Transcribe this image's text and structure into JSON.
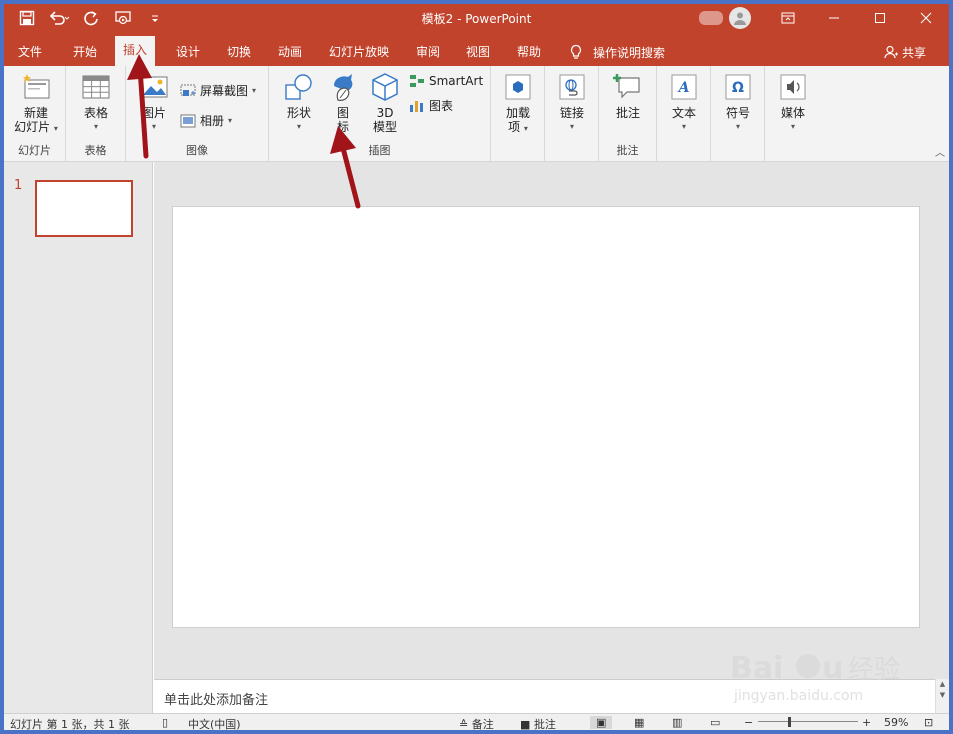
{
  "window": {
    "title": "模板2  -  PowerPoint",
    "buttons": {
      "restore": "⧉",
      "minimize": "—",
      "maximize": "☐",
      "close": "✕"
    }
  },
  "tabs": [
    {
      "label": "文件"
    },
    {
      "label": "开始"
    },
    {
      "label": "插入",
      "active": true
    },
    {
      "label": "设计"
    },
    {
      "label": "切换"
    },
    {
      "label": "动画"
    },
    {
      "label": "幻灯片放映"
    },
    {
      "label": "审阅"
    },
    {
      "label": "视图"
    },
    {
      "label": "帮助"
    }
  ],
  "tell_me": "操作说明搜索",
  "share": "共享",
  "ribbon": {
    "new_slide": {
      "line1": "新建",
      "line2": "幻灯片"
    },
    "slides_group": "幻灯片",
    "table": "表格",
    "tables_group": "表格",
    "pictures": "图片",
    "screenshot": "屏幕截图",
    "album": "相册",
    "images_group": "图像",
    "shapes": "形状",
    "icons": {
      "line1": "图",
      "line2": "标"
    },
    "model3d": {
      "line1": "3D",
      "line2": "模型"
    },
    "smartart": "SmartArt",
    "chart": "图表",
    "illustrations_group": "插图",
    "addins": {
      "line1": "加载",
      "line2": "项"
    },
    "links": "链接",
    "comment": "批注",
    "comments_group": "批注",
    "text": "文本",
    "symbols": "符号",
    "media": "媒体"
  },
  "slides_panel": {
    "slide_number": "1"
  },
  "notes_placeholder": "单击此处添加备注",
  "statusbar": {
    "slide_info": "幻灯片 第 1 张，共 1 张",
    "language": "中文(中国)",
    "notes": "备注",
    "comments": "批注",
    "zoom": "59%"
  },
  "colors": {
    "accent": "#c1432c",
    "annotation_arrow": "#a0141a"
  }
}
